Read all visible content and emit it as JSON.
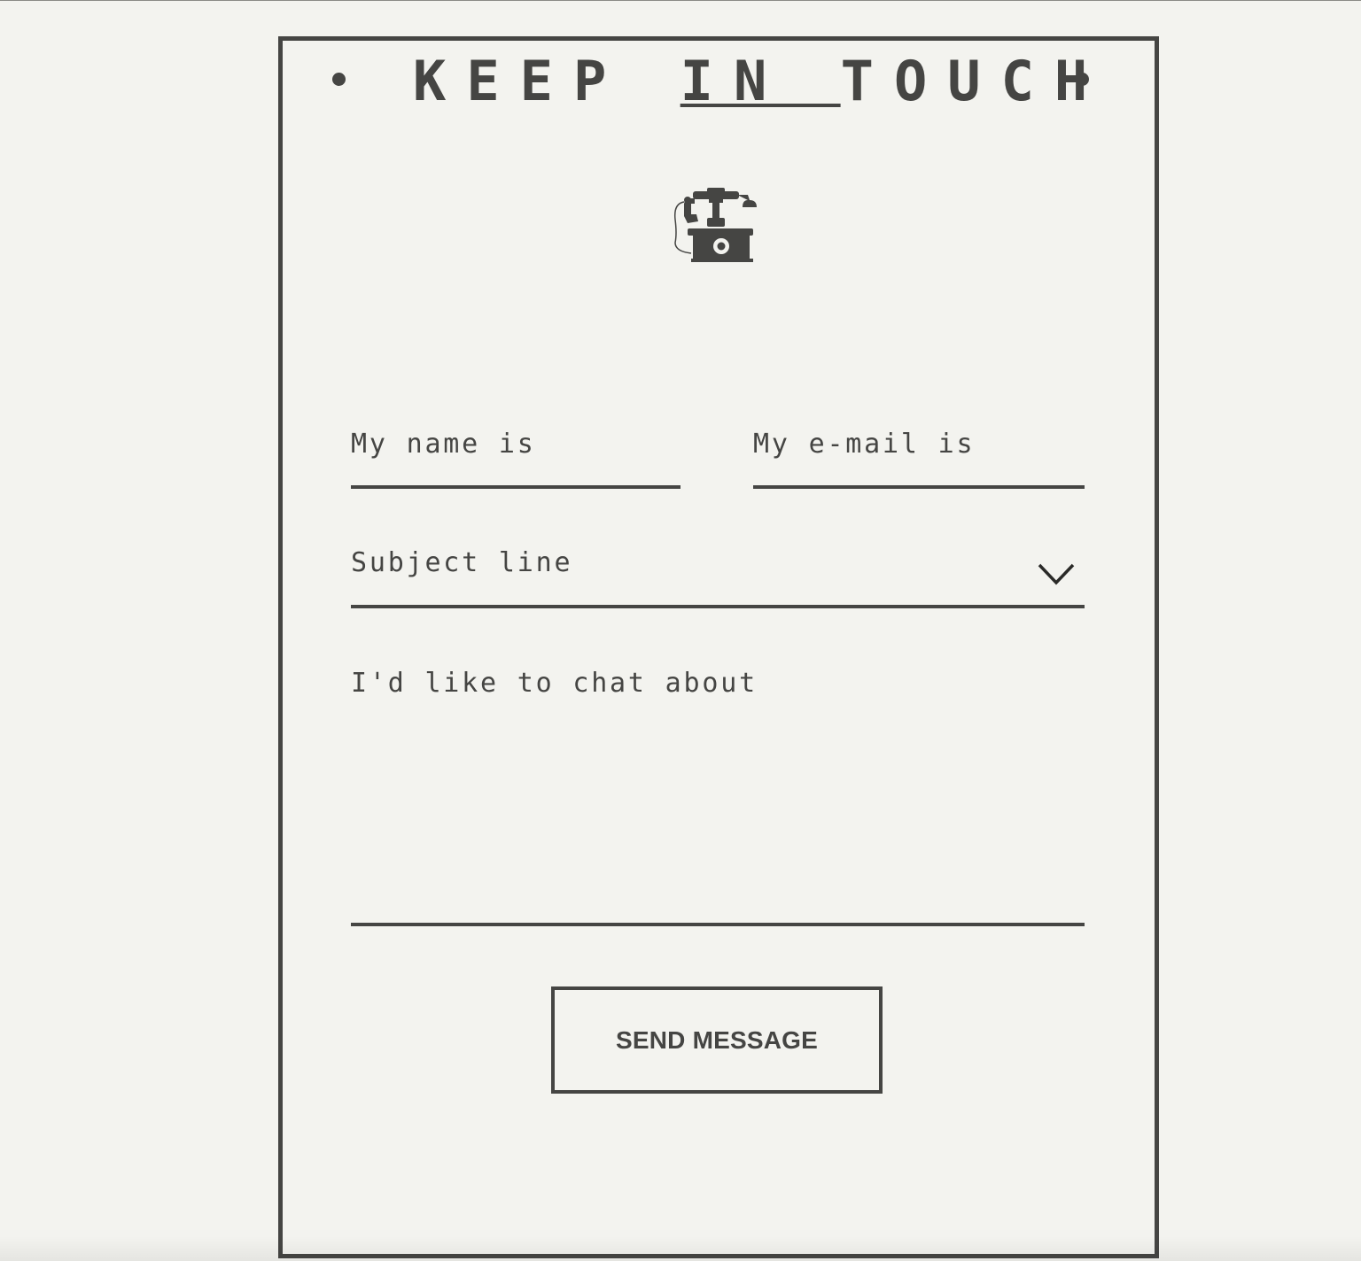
{
  "header": {
    "title_part1": "KEEP ",
    "title_part2": "IN ",
    "title_part3": "TOUCH",
    "bullet_left": "•",
    "bullet_right": "•"
  },
  "icons": {
    "hero": "vintage-telephone-icon",
    "subject_dropdown": "chevron-down-icon"
  },
  "form": {
    "name_placeholder": "My name is",
    "email_placeholder": "My e-mail is",
    "subject_placeholder": "Subject line",
    "message_placeholder": "I'd like to chat about",
    "submit_label": "SEND MESSAGE"
  },
  "colors": {
    "background": "#f3f3ef",
    "ink": "#454543"
  }
}
